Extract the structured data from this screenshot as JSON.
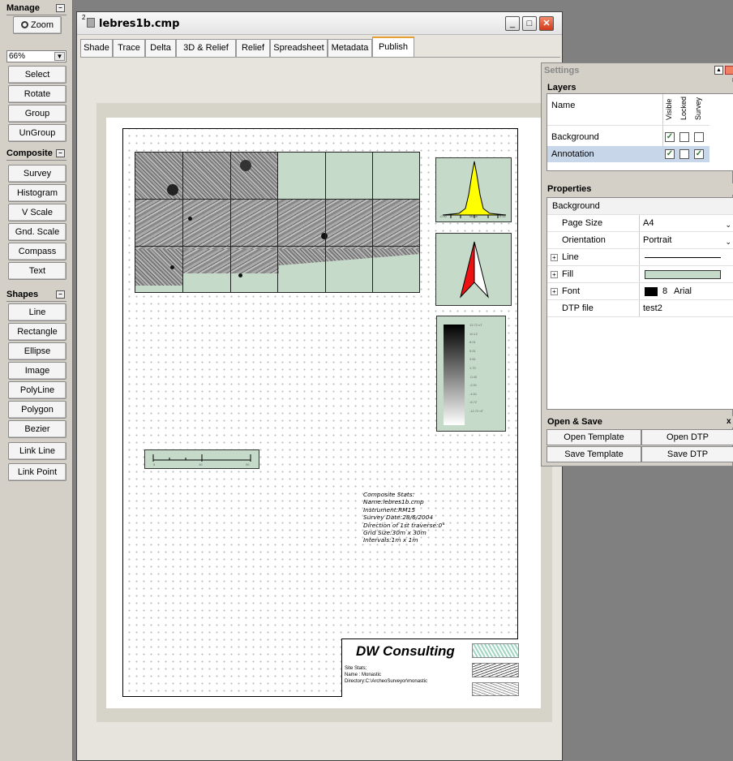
{
  "manage": {
    "title": "Manage",
    "zoom_label": "Zoom",
    "zoom_value": "66%",
    "buttons": [
      "Select",
      "Rotate",
      "Group",
      "UnGroup"
    ]
  },
  "composite": {
    "title": "Composite",
    "buttons": [
      "Survey",
      "Histogram",
      "V Scale",
      "Gnd. Scale",
      "Compass",
      "Text"
    ]
  },
  "shapes": {
    "title": "Shapes",
    "buttons": [
      "Line",
      "Rectangle",
      "Ellipse",
      "Image",
      "PolyLine",
      "Polygon",
      "Bezier",
      "Link Line",
      "Link Point"
    ]
  },
  "window": {
    "number": "2",
    "title": "lebres1b.cmp",
    "tabs": [
      "Shade",
      "Trace",
      "Delta",
      "3D & Relief",
      "Relief",
      "Spreadsheet",
      "Metadata",
      "Publish"
    ],
    "active_tab": "Publish"
  },
  "canvas": {
    "stats_text": [
      "Composite Stats:",
      "Name:lebres1b.cmp",
      "Instrument:RM15",
      "Survey Date:28/6/2004",
      "Direction of 1st traverse:0°",
      "Grid Size:30m x 30m",
      "Intervals:1m x 1m"
    ],
    "company": "DW Consulting",
    "site_text": [
      "Site Stats;",
      "Name : Monastic",
      "Directory:C:\\ArcheoSurveyor\\monastic"
    ],
    "histogram_labels": [
      "-0.92",
      "Mean",
      "0.92"
    ],
    "vscale_labels": [
      "12.72 nT",
      "10.12",
      "8.01",
      "5.91",
      "3.81",
      "1.70",
      "-0.40",
      "-2.51",
      "-4.61",
      "-6.72",
      "-12.72 nT"
    ],
    "gscale_labels": [
      "0",
      "10",
      "20"
    ]
  },
  "settings": {
    "title": "Settings",
    "layers_title": "Layers",
    "col_name": "Name",
    "col_visible": "Visible",
    "col_locked": "Locked",
    "col_survey": "Survey",
    "layers": [
      {
        "name": "Background",
        "visible": true,
        "locked": false,
        "survey": false
      },
      {
        "name": "Annotation",
        "visible": true,
        "locked": false,
        "survey": true
      }
    ],
    "properties_title": "Properties",
    "properties_object": "Background",
    "page_size_label": "Page Size",
    "page_size": "A4",
    "orientation_label": "Orientation",
    "orientation": "Portrait",
    "line_label": "Line",
    "fill_label": "Fill",
    "font_label": "Font",
    "font_size": "8",
    "font_name": "Arial",
    "dtp_label": "DTP file",
    "dtp_value": "test2",
    "open_save_title": "Open & Save",
    "open_template": "Open Template",
    "open_dtp": "Open DTP",
    "save_template": "Save Template",
    "save_dtp": "Save DTP",
    "fill_color": "#c5dac8"
  }
}
